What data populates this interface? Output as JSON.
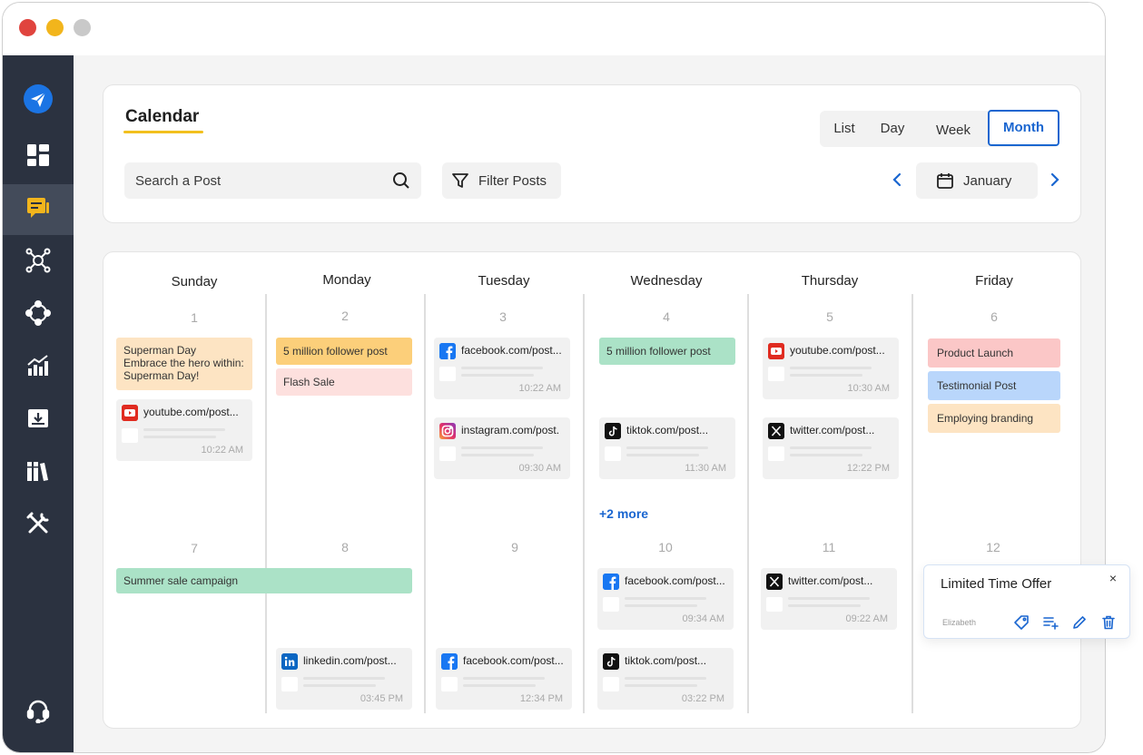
{
  "window": {
    "controls": [
      "close",
      "minimize",
      "maximize"
    ],
    "control_colors": {
      "close": "#e0443e",
      "minimize": "#f2b51c",
      "maximize": "#c9c9c9"
    }
  },
  "sidebar": {
    "items": [
      {
        "name": "send-icon",
        "active": false
      },
      {
        "name": "dashboard-icon",
        "active": false
      },
      {
        "name": "compose-icon",
        "active": true
      },
      {
        "name": "network-icon",
        "active": false
      },
      {
        "name": "nodes-icon",
        "active": false
      },
      {
        "name": "analytics-icon",
        "active": false
      },
      {
        "name": "inbox-download-icon",
        "active": false
      },
      {
        "name": "library-icon",
        "active": false
      },
      {
        "name": "tools-icon",
        "active": false
      },
      {
        "name": "support-headset-icon",
        "active": false
      }
    ]
  },
  "header": {
    "title": "Calendar",
    "search_placeholder": "Search a Post",
    "filter_label": "Filter Posts",
    "views": [
      "List",
      "Day",
      "Week",
      "Month"
    ],
    "active_view": "Month",
    "month": "January"
  },
  "calendar": {
    "days": [
      "Sunday",
      "Monday",
      "Tuesday",
      "Wednesday",
      "Thursday",
      "Friday"
    ],
    "week1_dates": [
      "1",
      "2",
      "3",
      "4",
      "5",
      "6"
    ],
    "week2_dates": [
      "7",
      "8",
      "9",
      "10",
      "11",
      "12"
    ],
    "chips": {
      "sun1": "Superman Day\nEmbrace the hero within: Superman Day!",
      "mon1a": "5 million follower post",
      "mon1b": "Flash Sale",
      "wed1": "5 million follower post",
      "fri1a": "Product Launch",
      "fri1b": "Testimonial Post",
      "fri1c": "Employing branding",
      "week2_span": "Summer sale campaign"
    },
    "posts": {
      "sun1": {
        "url": "youtube.com/post...",
        "time": "10:22 AM",
        "icon": "youtube-icon"
      },
      "tue1a": {
        "url": "facebook.com/post...",
        "time": "10:22 AM",
        "icon": "facebook-icon"
      },
      "tue1b": {
        "url": "instagram.com/post.",
        "time": "09:30 AM",
        "icon": "instagram-icon"
      },
      "wed1": {
        "url": "tiktok.com/post...",
        "time": "11:30 AM",
        "icon": "tiktok-icon"
      },
      "thu1a": {
        "url": "youtube.com/post...",
        "time": "10:30 AM",
        "icon": "youtube-icon"
      },
      "thu1b": {
        "url": "twitter.com/post...",
        "time": "12:22 PM",
        "icon": "x-icon"
      },
      "mon2": {
        "url": "linkedin.com/post...",
        "time": "03:45 PM",
        "icon": "linkedin-icon"
      },
      "tue2": {
        "url": "facebook.com/post...",
        "time": "12:34 PM",
        "icon": "facebook-icon"
      },
      "wed2a": {
        "url": "facebook.com/post...",
        "time": "09:34 AM",
        "icon": "facebook-icon"
      },
      "wed2b": {
        "url": "tiktok.com/post...",
        "time": "03:22 PM",
        "icon": "tiktok-icon"
      },
      "thu2": {
        "url": "twitter.com/post...",
        "time": "09:22 AM",
        "icon": "x-icon"
      }
    },
    "more_label": "+2 more"
  },
  "popover": {
    "title": "Limited Time Offer",
    "author": "Elizabeth",
    "close_glyph": "×",
    "actions": [
      "tag-icon",
      "add-to-list-icon",
      "edit-icon",
      "delete-icon"
    ]
  },
  "colors": {
    "accent_blue": "#1a66d0",
    "title_underline": "#f2c01e",
    "chip_peach": "#fde4c3",
    "chip_orange": "#fccf7a",
    "chip_pink": "#fde0de",
    "chip_green": "#abe2c7",
    "chip_rose": "#fbc7c7",
    "chip_blue": "#b9d6fb",
    "sidebar": "#2b3240"
  }
}
